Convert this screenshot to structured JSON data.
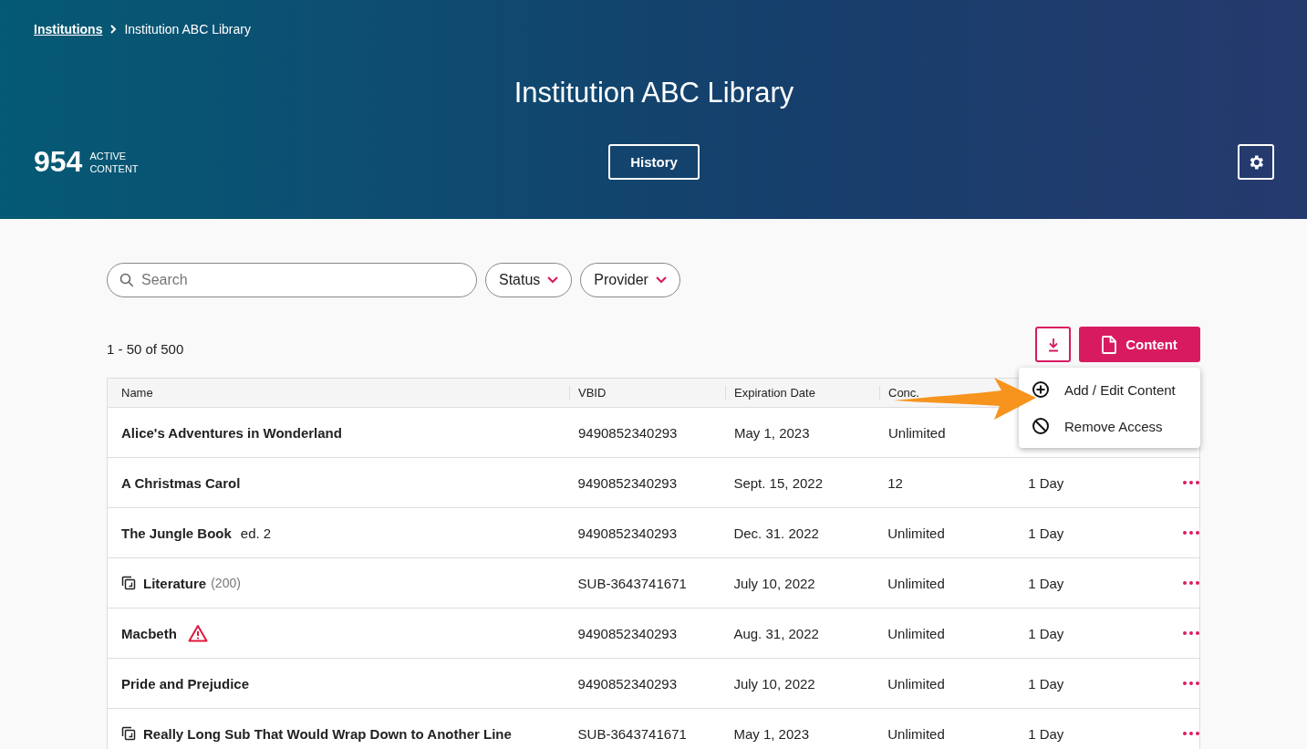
{
  "breadcrumb": {
    "link": "Institutions",
    "current": "Institution ABC Library"
  },
  "title": "Institution ABC Library",
  "stat": {
    "count": "954",
    "label_line_1": "ACTIVE",
    "label_line_2": "CONTENT"
  },
  "history_button": "History",
  "search": {
    "placeholder": "Search"
  },
  "filters": [
    "Status",
    "Provider"
  ],
  "range": "1 - 50 of 500",
  "content_button": "Content",
  "menu": {
    "items": [
      {
        "kind": "add",
        "label": "Add / Edit Content"
      },
      {
        "kind": "remove",
        "label": "Remove Access"
      }
    ]
  },
  "table": {
    "columns": [
      "Name",
      "VBID",
      "Expiration Date",
      "Conc."
    ],
    "rows": [
      {
        "name": "Alice's Adventures in Wonderland",
        "kind": "plain",
        "vbid": "9490852340293",
        "expires": "May 1, 2023",
        "users": "Unlimited"
      },
      {
        "name": "A Christmas Carol",
        "kind": "plain",
        "vbid": "9490852340293",
        "expires": "Sept. 15, 2022",
        "users": "12",
        "duration": "1 Day"
      },
      {
        "name": "The Jungle Book",
        "note": "ed. 2",
        "kind": "plain",
        "vbid": "9490852340293",
        "expires": "Dec. 31. 2022",
        "users": "Unlimited",
        "duration": "1 Day"
      },
      {
        "name": "Literature",
        "count": "(200)",
        "kind": "collection",
        "vbid": "SUB-3643741671",
        "expires": "July 10, 2022",
        "users": "Unlimited",
        "duration": "1 Day"
      },
      {
        "name": "Macbeth",
        "kind": "warning",
        "vbid": "9490852340293",
        "expires": "Aug. 31, 2022",
        "users": "Unlimited",
        "duration": "1 Day"
      },
      {
        "name": "Pride and Prejudice",
        "kind": "plain",
        "vbid": "9490852340293",
        "expires": "July 10, 2022",
        "users": "Unlimited",
        "duration": "1 Day"
      },
      {
        "name": "Really Long Sub That Would Wrap Down to Another Line",
        "kind": "collection",
        "vbid": "SUB-3643741671",
        "expires": "May 1, 2023",
        "users": "Unlimited",
        "duration": "1 Day"
      }
    ]
  }
}
